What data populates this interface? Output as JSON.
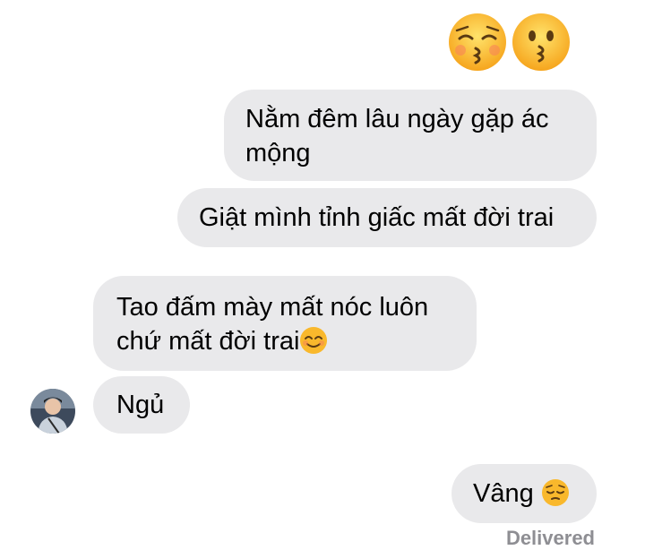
{
  "top_emojis": [
    {
      "name": "kissing-face-with-closed-eyes"
    },
    {
      "name": "kissing-face"
    }
  ],
  "messages": [
    {
      "side": "sent",
      "lines": [
        "Nằm đêm lâu ngày gặp ác",
        "mộng"
      ]
    },
    {
      "side": "sent",
      "lines": [
        "Giật mình tỉnh giấc mất đời trai"
      ]
    },
    {
      "side": "received",
      "lines": [
        "Tao đấm mày mất nóc luôn",
        "chứ mất đời trai"
      ],
      "emoji": "smiling-face-with-smiling-eyes"
    },
    {
      "side": "received",
      "lines": [
        "Ngủ"
      ]
    },
    {
      "side": "sent",
      "lines": [
        "Vâng"
      ],
      "emoji": "pensive-face"
    }
  ],
  "status": "Delivered",
  "colors": {
    "bubble_bg": "#e9e9eb",
    "text": "#000000",
    "status": "#8e8e93",
    "emoji_yellow": "#f9b82c"
  }
}
